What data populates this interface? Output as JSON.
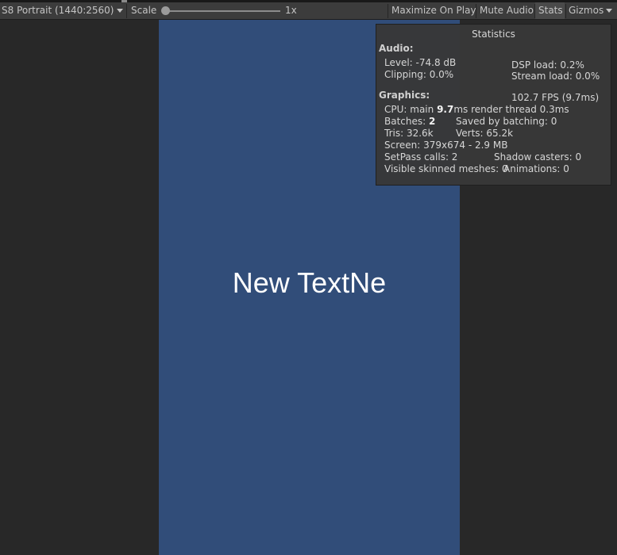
{
  "toolbar": {
    "resolution": "S8 Portrait (1440:2560)",
    "scale_label": "Scale",
    "scale_value": "1x",
    "maximize": "Maximize On Play",
    "mute": "Mute Audio",
    "stats": "Stats",
    "gizmos": "Gizmos"
  },
  "game": {
    "text": "New TextNe",
    "background": "#314d79"
  },
  "stats": {
    "title": "Statistics",
    "audio": {
      "heading": "Audio:",
      "level": "Level: -74.8 dB",
      "clipping": "Clipping: 0.0%",
      "dsp": "DSP load: 0.2%",
      "stream": "Stream load: 0.0%"
    },
    "graphics": {
      "heading": "Graphics:",
      "fps": "102.7 FPS (9.7ms)",
      "cpu_prefix": "CPU: main",
      "cpu_main": "9.7",
      "cpu_suffix": "ms  render thread 0.3ms",
      "batches_label": "Batches:",
      "batches": "2",
      "saved": "Saved by batching: 0",
      "tris": "Tris: 32.6k",
      "verts": "Verts: 65.2k",
      "screen": "Screen: 379x674 - 2.9 MB",
      "setpass": "SetPass calls: 2",
      "shadow": "Shadow casters: 0",
      "skinned": "Visible skinned meshes: 0",
      "animations": "Animations: 0"
    }
  }
}
